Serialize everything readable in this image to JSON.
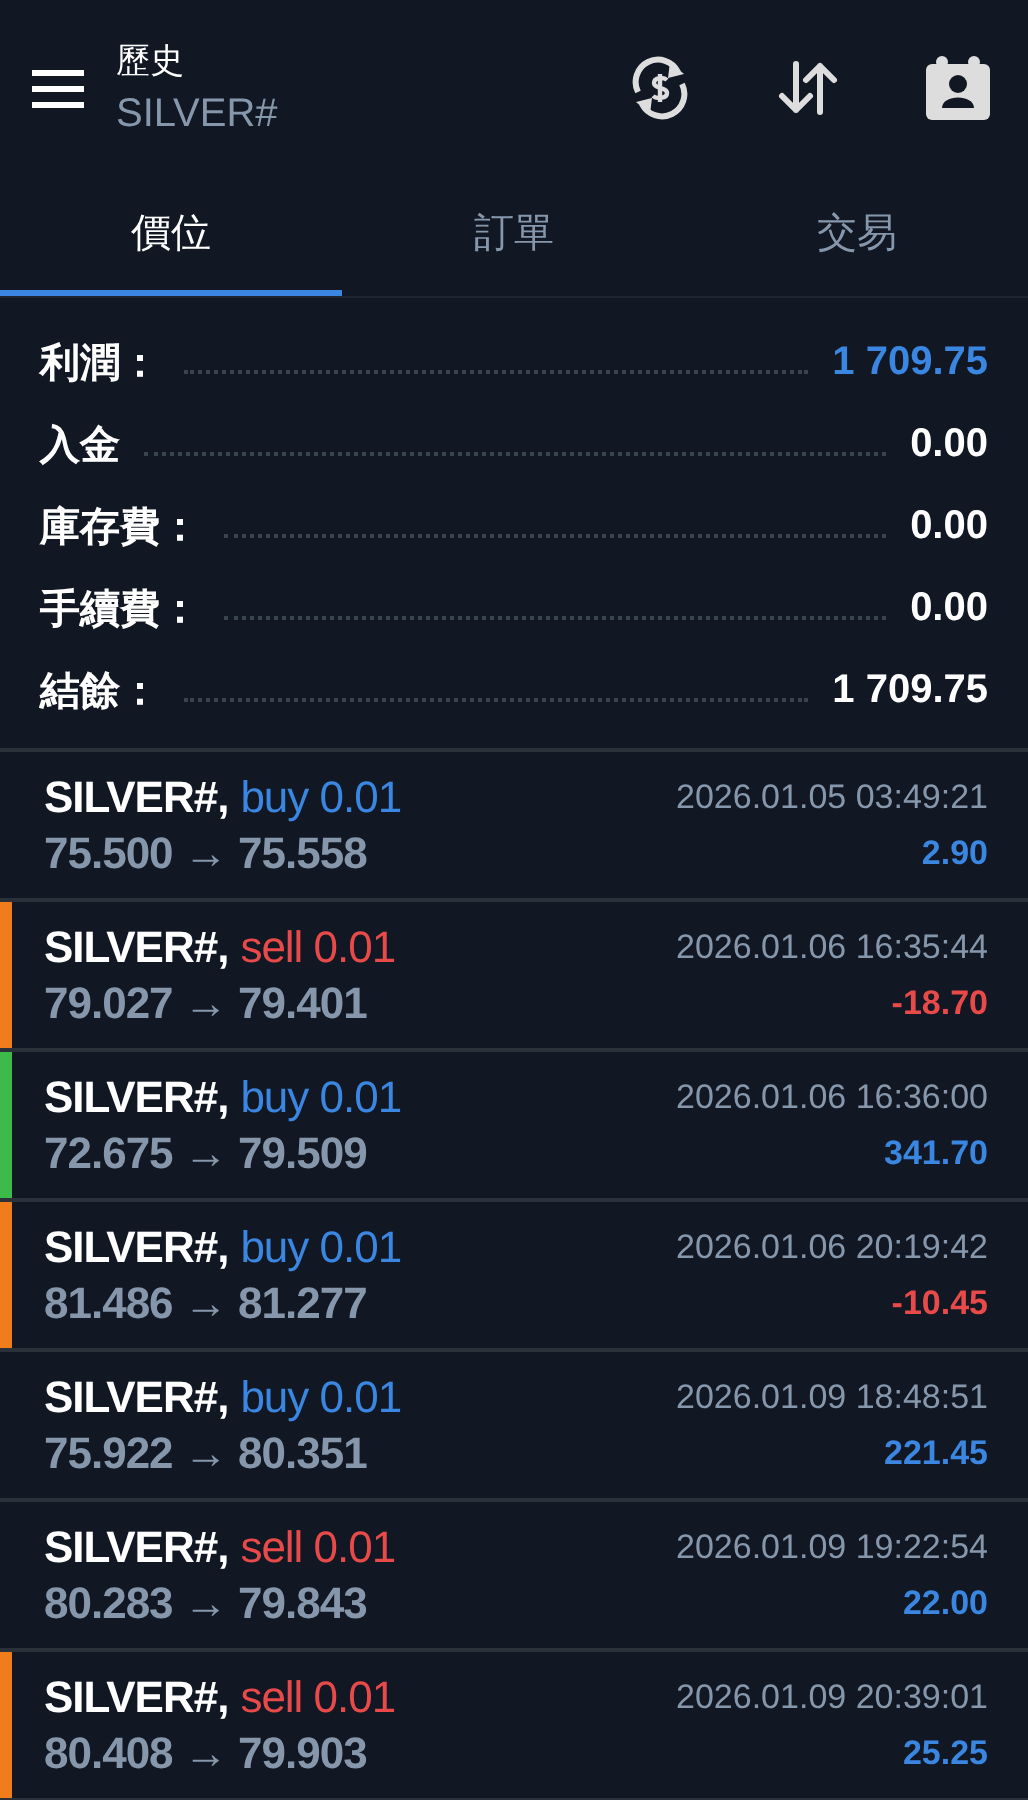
{
  "header": {
    "title": "歷史",
    "subtitle": "SILVER#"
  },
  "tabs": [
    {
      "label": "價位",
      "selected": true
    },
    {
      "label": "訂單",
      "selected": false
    },
    {
      "label": "交易",
      "selected": false
    }
  ],
  "summary": [
    {
      "label": "利潤：",
      "value": "1 709.75",
      "highlight": true
    },
    {
      "label": "入金",
      "value": "0.00",
      "highlight": false
    },
    {
      "label": "庫存費：",
      "value": "0.00",
      "highlight": false
    },
    {
      "label": "手續費：",
      "value": "0.00",
      "highlight": false
    },
    {
      "label": "結餘：",
      "value": "1 709.75",
      "highlight": false
    }
  ],
  "deals": [
    {
      "symbol": "SILVER#,",
      "trade": "buy 0.01",
      "kind": "buy",
      "prices": "75.500 → 75.558",
      "time": "2026.01.05 03:49:21",
      "profit": "2.90",
      "loss": false
    },
    {
      "symbol": "SILVER#,",
      "trade": "sell 0.01",
      "kind": "sell",
      "prices": "79.027 → 79.401",
      "time": "2026.01.06 16:35:44",
      "profit": "-18.70",
      "loss": true,
      "color": "#f07c1c"
    },
    {
      "symbol": "SILVER#,",
      "trade": "buy 0.01",
      "kind": "buy",
      "prices": "72.675 → 79.509",
      "time": "2026.01.06 16:36:00",
      "profit": "341.70",
      "loss": false,
      "color": "#3cba4a"
    },
    {
      "symbol": "SILVER#,",
      "trade": "buy 0.01",
      "kind": "buy",
      "prices": "81.486 → 81.277",
      "time": "2026.01.06 20:19:42",
      "profit": "-10.45",
      "loss": true,
      "color": "#f07c1c"
    },
    {
      "symbol": "SILVER#,",
      "trade": "buy 0.01",
      "kind": "buy",
      "prices": "75.922 → 80.351",
      "time": "2026.01.09 18:48:51",
      "profit": "221.45",
      "loss": false
    },
    {
      "symbol": "SILVER#,",
      "trade": "sell 0.01",
      "kind": "sell",
      "prices": "80.283 → 79.843",
      "time": "2026.01.09 19:22:54",
      "profit": "22.00",
      "loss": false
    },
    {
      "symbol": "SILVER#,",
      "trade": "sell 0.01",
      "kind": "sell",
      "prices": "80.408 → 79.903",
      "time": "2026.01.09 20:39:01",
      "profit": "25.25",
      "loss": false,
      "color": "#f07c1c"
    }
  ]
}
